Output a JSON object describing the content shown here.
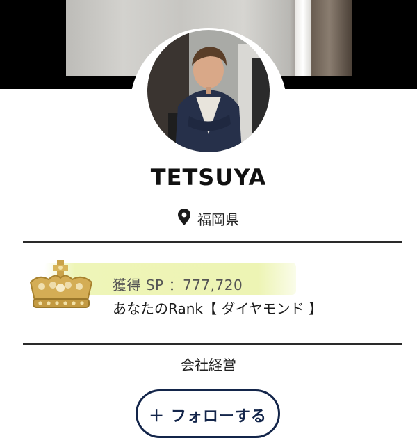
{
  "profile": {
    "name": "TETSUYA",
    "location": "福岡県",
    "occupation": "会社経営"
  },
  "points": {
    "label": "獲得 SP ：777,720",
    "rank_text": "あなたのRank【 ダイヤモンド 】"
  },
  "actions": {
    "follow_label": "＋ フォローする"
  },
  "icons": {
    "location": "map-pin-icon",
    "rank": "crown-icon"
  },
  "colors": {
    "accent": "#13254a",
    "highlight": "#eef5b8",
    "divider": "#2a2a2a"
  }
}
